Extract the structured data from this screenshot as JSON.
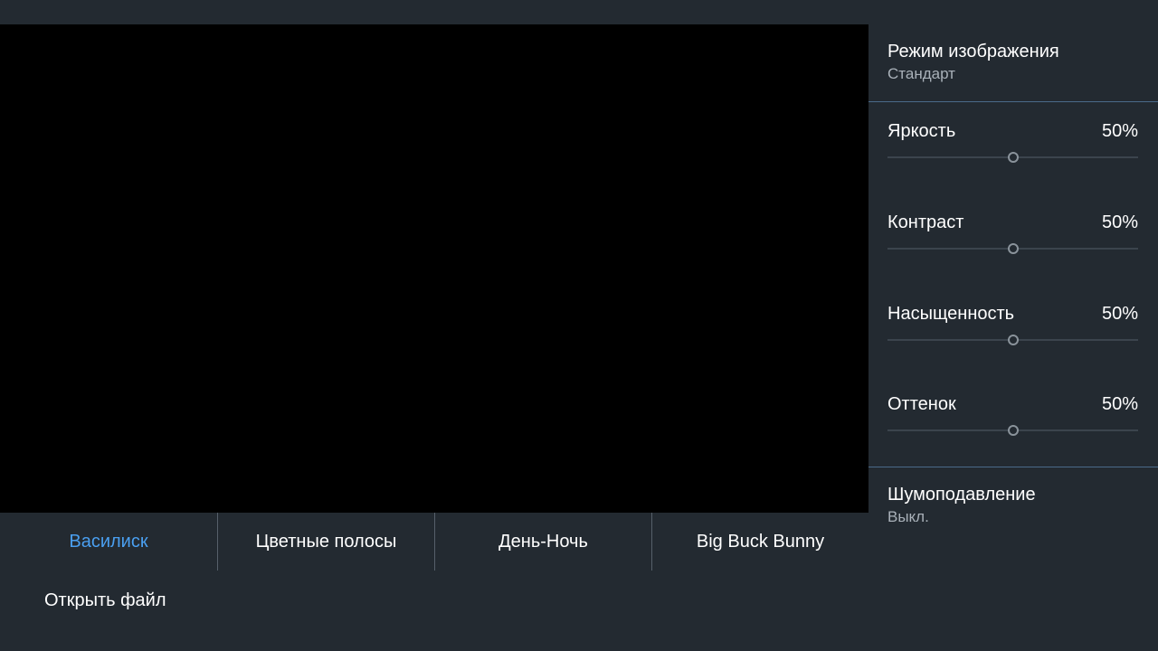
{
  "settings": {
    "picture_mode": {
      "title": "Режим изображения",
      "value": "Стандарт"
    },
    "sliders": [
      {
        "label": "Яркость",
        "value_text": "50%",
        "level": 0.5
      },
      {
        "label": "Контраст",
        "value_text": "50%",
        "level": 0.5
      },
      {
        "label": "Насыщенность",
        "value_text": "50%",
        "level": 0.5
      },
      {
        "label": "Оттенок",
        "value_text": "50%",
        "level": 0.5
      }
    ],
    "noise_reduction": {
      "title": "Шумоподавление",
      "value": "Выкл."
    }
  },
  "sources": {
    "tabs": [
      {
        "label": "Василиск",
        "active": true
      },
      {
        "label": "Цветные полосы",
        "active": false
      },
      {
        "label": "День-Ночь",
        "active": false
      },
      {
        "label": "Big Buck Bunny",
        "active": false
      }
    ],
    "open_file_label": "Открыть файл"
  },
  "colors": {
    "accent": "#4a9ff0",
    "background": "#232a31",
    "video": "#000000"
  }
}
